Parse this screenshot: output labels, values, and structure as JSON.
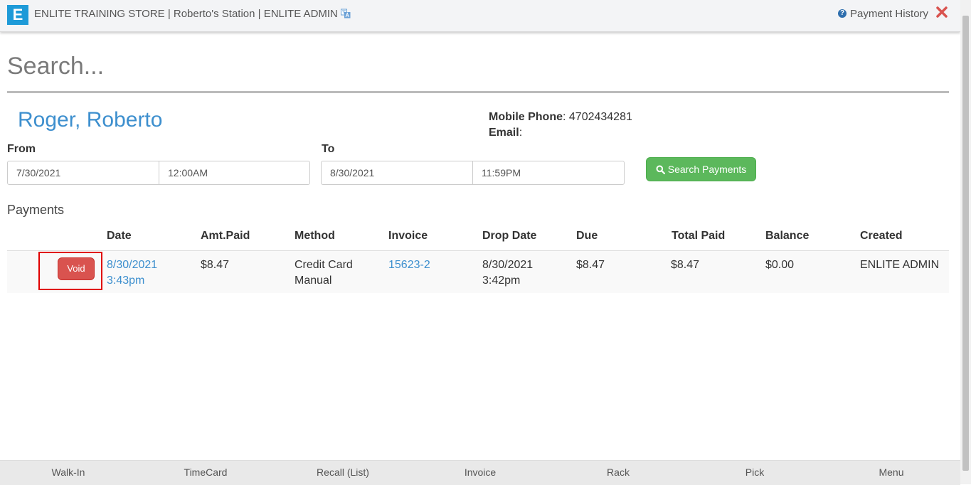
{
  "header": {
    "store_title": "ENLITE TRAINING STORE | Roberto's Station | ENLITE ADMIN",
    "payment_history_label": "Payment History"
  },
  "search": {
    "placeholder": "Search..."
  },
  "customer": {
    "name": "Roger, Roberto",
    "mobile_phone_label": "Mobile Phone",
    "mobile_phone": "4702434281",
    "email_label": "Email",
    "email": ""
  },
  "filters": {
    "from_label": "From",
    "from_date": "7/30/2021",
    "from_time": "12:00AM",
    "to_label": "To",
    "to_date": "8/30/2021",
    "to_time": "11:59PM",
    "search_button_label": "Search Payments"
  },
  "payments": {
    "section_label": "Payments",
    "columns": [
      "Date",
      "Amt.Paid",
      "Method",
      "Invoice",
      "Drop Date",
      "Due",
      "Total Paid",
      "Balance",
      "Created"
    ],
    "rows": [
      {
        "void_label": "Void",
        "date": "8/30/2021",
        "time": "3:43pm",
        "amt_paid": "$8.47",
        "method_line1": "Credit Card",
        "method_line2": "Manual",
        "invoice": "15623-2",
        "drop_date": "8/30/2021",
        "drop_time": "3:42pm",
        "due": "$8.47",
        "total_paid": "$8.47",
        "balance": "$0.00",
        "created": "ENLITE ADMIN"
      }
    ]
  },
  "bottom_nav": {
    "items": [
      "Walk-In",
      "TimeCard",
      "Recall (List)",
      "Invoice",
      "Rack",
      "Pick",
      "Menu"
    ]
  },
  "colors": {
    "accent_blue": "#3d8fce",
    "logo_blue": "#1d9ad8",
    "success_green": "#5cb85c",
    "danger_red": "#d9534f",
    "close_red": "#d9534f",
    "highlight_red": "#e00000"
  },
  "icons": {
    "logo": "enlite-logo-icon",
    "translate": "translate-icon",
    "help": "question-circle-icon",
    "close": "close-icon",
    "search": "search-icon"
  }
}
